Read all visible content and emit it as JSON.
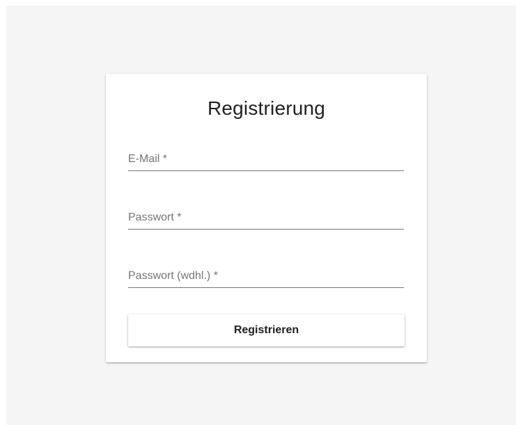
{
  "form": {
    "title": "Registrierung",
    "fields": [
      {
        "label": "E-Mail *",
        "value": ""
      },
      {
        "label": "Passwort *",
        "value": ""
      },
      {
        "label": "Passwort (wdhl.) *",
        "value": ""
      }
    ],
    "submit_label": "Registrieren"
  },
  "colors": {
    "page_background": "#f5f5f5",
    "card_background": "#ffffff",
    "text": "#212121",
    "label": "#757575"
  }
}
